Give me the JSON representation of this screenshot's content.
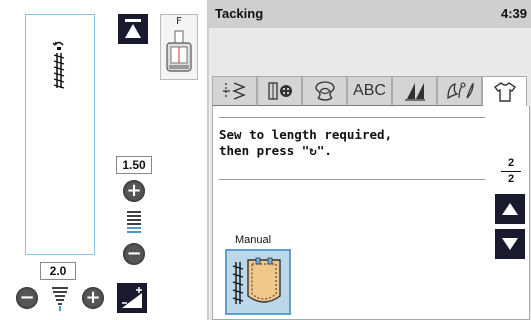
{
  "header": {
    "title": "Tacking",
    "clock": "4:39"
  },
  "left": {
    "foot_label": "F",
    "length_value": "1.50",
    "width_value": "2.0"
  },
  "tabs": [
    {
      "name": "utility-stitches",
      "label": ""
    },
    {
      "name": "buttonhole",
      "label": ""
    },
    {
      "name": "decorative",
      "label": ""
    },
    {
      "name": "alphabet",
      "label": "ABC"
    },
    {
      "name": "satin",
      "label": ""
    },
    {
      "name": "floral",
      "label": ""
    },
    {
      "name": "quilting",
      "label": ""
    }
  ],
  "content": {
    "message_line1": "Sew to length required,",
    "message_line2": "then press \"↻\".",
    "page_current": "2",
    "page_total": "2",
    "mode_label": "Manual"
  },
  "colors": {
    "accent": "#5ba0d0",
    "dark_button": "#1a1a2e",
    "panel_bg": "#e9e9e9",
    "header_bg": "#cfcfcf"
  }
}
